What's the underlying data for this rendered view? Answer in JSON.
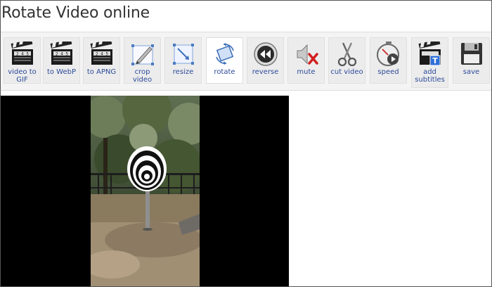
{
  "page": {
    "title": "Rotate Video online"
  },
  "toolbar": {
    "items": [
      {
        "label": "video to GIF",
        "icon": "clapperboard-icon"
      },
      {
        "label": "to WebP",
        "icon": "clapperboard-icon"
      },
      {
        "label": "to APNG",
        "icon": "clapperboard-icon"
      },
      {
        "label": "crop video",
        "icon": "crop-icon"
      },
      {
        "label": "resize",
        "icon": "resize-icon"
      },
      {
        "label": "rotate",
        "icon": "rotate-icon",
        "active": true
      },
      {
        "label": "reverse",
        "icon": "rewind-icon"
      },
      {
        "label": "mute",
        "icon": "mute-icon"
      },
      {
        "label": "cut video",
        "icon": "scissors-icon"
      },
      {
        "label": "speed",
        "icon": "stopwatch-icon"
      },
      {
        "label": "add subtitles",
        "icon": "subtitles-icon"
      },
      {
        "label": "save",
        "icon": "floppy-disk-icon"
      }
    ]
  },
  "colors": {
    "accent": "#2c4a9a",
    "toolbar_bg": "#f4f4f4",
    "video_bg": "#000000"
  }
}
